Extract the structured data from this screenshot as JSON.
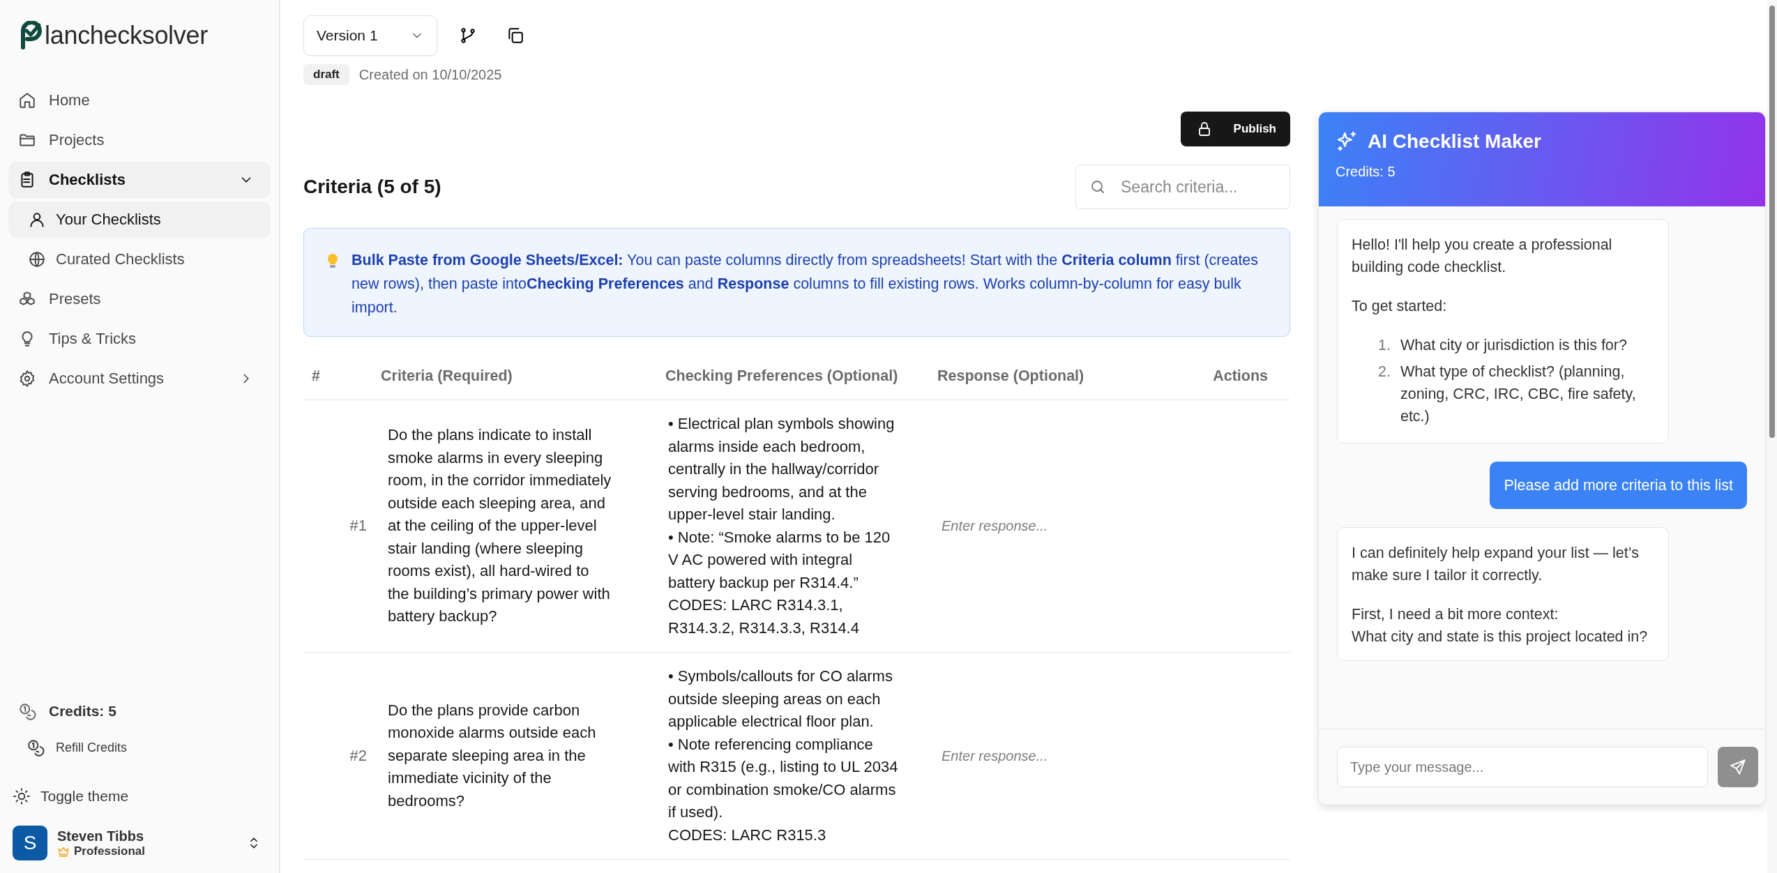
{
  "logo": {
    "text": "lanchecksolver"
  },
  "sidebar": {
    "nav": [
      {
        "label": "Home",
        "selected": false
      },
      {
        "label": "Projects",
        "selected": false
      },
      {
        "label": "Checklists",
        "selected": true,
        "expanded": true,
        "children": [
          {
            "label": "Your Checklists",
            "selected": true
          },
          {
            "label": "Curated Checklists",
            "selected": false
          }
        ]
      },
      {
        "label": "Presets",
        "selected": false
      },
      {
        "label": "Tips & Tricks",
        "selected": false
      },
      {
        "label": "Account Settings",
        "selected": false,
        "expanded": false
      }
    ],
    "credits": "Credits: 5",
    "refill": "Refill Credits",
    "theme_toggle": "Toggle theme",
    "user": {
      "initial": "S",
      "name": "Steven Tibbs",
      "plan": "Professional"
    }
  },
  "toolbar": {
    "version": "Version 1",
    "status": "draft",
    "created": "Created on 10/10/2025",
    "publish": "Publish"
  },
  "criteria": {
    "title": "Criteria (5 of 5)",
    "search": {
      "placeholder": "Search criteria..."
    },
    "tip": "**Bulk Paste from Google Sheets/Excel:** You can paste columns directly from spreadsheets! Start with the **Criteria column** first (creates new rows), then paste into**Checking Preferences** and **Response** columns to fill existing rows. Works column-by-column for easy bulk import.",
    "table": {
      "columns": [
        "#",
        "Criteria (Required)",
        "Checking Preferences (Optional)",
        "Response (Optional)",
        "Actions"
      ],
      "rows": [
        {
          "number": "#1",
          "criteria": "Do the plans indicate to install smoke alarms in every sleeping room, in the corridor immediately outside each sleeping area, and at the ceiling of the upper-level stair landing (where sleeping rooms exist), all hard-wired to the building’s primary power with battery backup?",
          "preferences": "• Electrical plan symbols showing alarms inside each bedroom, centrally in the hallway/corridor serving bedrooms, and at the upper-level stair landing.\n• Note: “Smoke alarms to be 120 V AC powered with integral battery backup per R314.4.”\nCODES: LARC R314.3.1, R314.3.2, R314.3.3, R314.4",
          "response": {
            "placeholder": "Enter response..."
          }
        },
        {
          "number": "#2",
          "criteria": "Do the plans provide carbon monoxide alarms outside each separate sleeping area in the immediate vicinity of the bedrooms?",
          "preferences": "• Symbols/callouts for CO alarms outside sleeping areas on each applicable electrical floor plan.\n• Note referencing compliance with R315 (e.g., listing to UL 2034 or combination smoke/CO alarms if used).\nCODES: LARC R315.3",
          "response": {
            "placeholder": "Enter response..."
          }
        }
      ]
    }
  },
  "chat": {
    "title": "AI Checklist Maker",
    "credits": "Credits: 5",
    "messages": [
      {
        "kind": "assistant",
        "paragraphs": [
          "Hello! I'll help you create a professional building code checklist.",
          "To get started:"
        ],
        "list": [
          {
            "number": "1.",
            "text": "What city or jurisdiction is this for?"
          },
          {
            "number": "2.",
            "text": "What type of checklist? (planning, zoning, CRC, IRC, CBC, fire safety, etc.)"
          }
        ]
      },
      {
        "kind": "user",
        "paragraphs": [
          "Please add more criteria to this list"
        ]
      },
      {
        "kind": "assistant",
        "paragraphs": [
          "I can definitely help expand your list — let’s make sure I tailor it correctly.",
          "First, I need a bit more context:\nWhat city and state is this project located in?"
        ]
      }
    ],
    "input": {
      "placeholder": "Type your message..."
    }
  }
}
